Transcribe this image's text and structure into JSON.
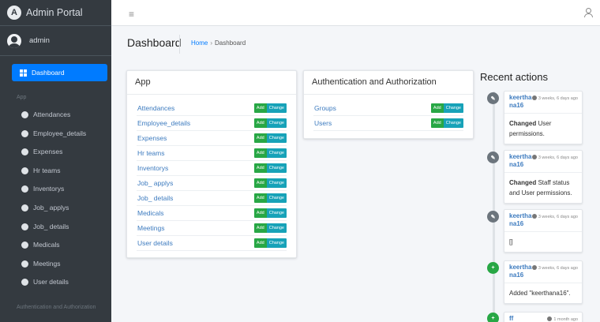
{
  "brand": {
    "title": "Admin Portal",
    "logo_letter": "A"
  },
  "user": {
    "name": "admin"
  },
  "sidebar": {
    "active_item": "Dashboard",
    "section_app": "App",
    "items": [
      "Attendances",
      "Employee_details",
      "Expenses",
      "Hr teams",
      "Inventorys",
      "Job_ applys",
      "Job_ details",
      "Medicals",
      "Meetings",
      "User details"
    ],
    "section_auth": "Authentication and Authorization"
  },
  "topbar": {
    "menu_icon": "hamburger-icon",
    "user_icon": "user-icon"
  },
  "header": {
    "title": "Dashboard",
    "breadcrumb_home": "Home",
    "breadcrumb_sep": "›",
    "breadcrumb_current": "Dashboard"
  },
  "app_card": {
    "title": "App",
    "rows": [
      "Attendances",
      "Employee_details",
      "Expenses",
      "Hr teams",
      "Inventorys",
      "Job_ applys",
      "Job_ details",
      "Medicals",
      "Meetings",
      "User details"
    ],
    "add_label": "Add",
    "change_label": "Change"
  },
  "auth_card": {
    "title": "Authentication and Authorization",
    "rows": [
      "Groups",
      "Users"
    ],
    "add_label": "Add",
    "change_label": "Change"
  },
  "recent": {
    "title": "Recent actions",
    "entries": [
      {
        "user": "keerthana16",
        "time": "3 weeks, 6 days ago",
        "action": "Changed",
        "text": "User permissions.",
        "icon": "edit-icon",
        "icon_glyph": "✎",
        "color": "#6c757d"
      },
      {
        "user": "keerthana16",
        "time": "3 weeks, 6 days ago",
        "action": "Changed",
        "text": "Staff status and User permissions.",
        "icon": "edit-icon",
        "icon_glyph": "✎",
        "color": "#6c757d"
      },
      {
        "user": "keerthana16",
        "time": "3 weeks, 6 days ago",
        "action": "",
        "text": "[]",
        "icon": "edit-icon",
        "icon_glyph": "✎",
        "color": "#6c757d"
      },
      {
        "user": "keerthana16",
        "time": "3 weeks, 6 days ago",
        "action": "",
        "text": "Added \"keerthana16\".",
        "icon": "add-icon",
        "icon_glyph": "+",
        "color": "#28a745"
      },
      {
        "user": "ff",
        "time": "1 month ago",
        "action": "",
        "text": "",
        "icon": "add-icon",
        "icon_glyph": "+",
        "color": "#28a745"
      }
    ]
  },
  "colors": {
    "sidebar_bg": "#343a40",
    "accent": "#007bff",
    "add": "#28a745",
    "change": "#17a2b8",
    "link": "#3d7bbf"
  }
}
